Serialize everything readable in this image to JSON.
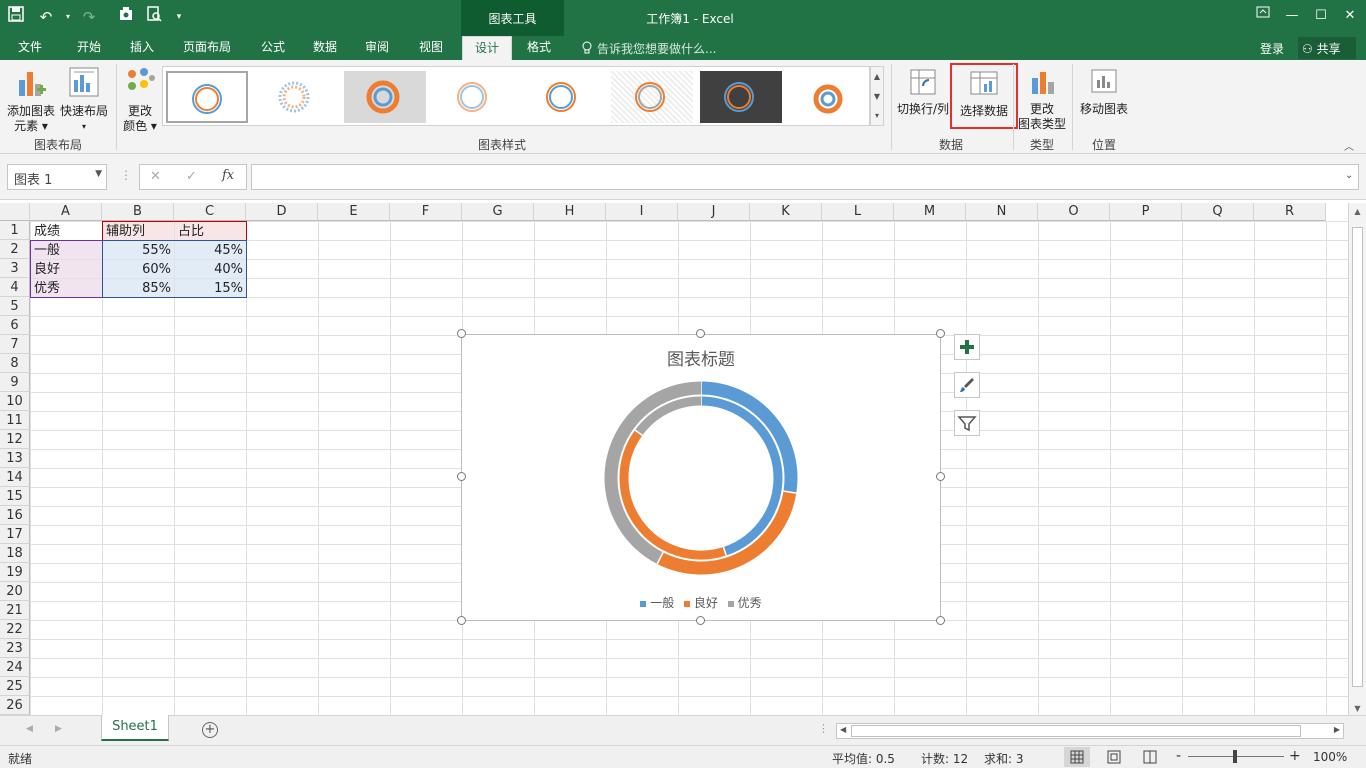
{
  "titlebar": {
    "context_tool_title": "图表工具",
    "doc_title": "工作簿1 - Excel"
  },
  "tabs": [
    {
      "label": "文件"
    },
    {
      "label": "开始"
    },
    {
      "label": "插入"
    },
    {
      "label": "页面布局"
    },
    {
      "label": "公式"
    },
    {
      "label": "数据"
    },
    {
      "label": "审阅"
    },
    {
      "label": "视图"
    },
    {
      "label": "设计"
    },
    {
      "label": "格式"
    }
  ],
  "tell_me": "告诉我您想要做什么...",
  "account": {
    "login": "登录",
    "share": "共享"
  },
  "ribbon": {
    "add_element": "添加图表",
    "add_element2": "元素",
    "quick_layout": "快速布局",
    "change_colors": "更改",
    "change_colors2": "颜色",
    "group_layout": "图表布局",
    "group_styles": "图表样式",
    "switch_row_col": "切换行/列",
    "select_data": "选择数据",
    "change_type": "更改",
    "change_type2": "图表类型",
    "move_chart": "移动图表",
    "group_data": "数据",
    "group_type": "类型",
    "group_location": "位置",
    "gallery_thumb_title": "图表标题"
  },
  "formula_bar": {
    "name_box": "图表 1",
    "fx": "fx",
    "cancel": "✕",
    "enter": "✓"
  },
  "sheet": {
    "columns": [
      "A",
      "B",
      "C",
      "D",
      "E",
      "F",
      "G",
      "H",
      "I",
      "J",
      "K",
      "L",
      "M",
      "N",
      "O",
      "P",
      "Q",
      "R"
    ],
    "rows": [
      "1",
      "2",
      "3",
      "4",
      "5",
      "6",
      "7",
      "8",
      "9",
      "10",
      "11",
      "12",
      "13",
      "14",
      "15",
      "16",
      "17",
      "18",
      "19",
      "20",
      "21",
      "22",
      "23",
      "24",
      "25",
      "26"
    ],
    "cells": [
      [
        "成绩",
        "辅助列",
        "占比"
      ],
      [
        "一般",
        "55%",
        "45%"
      ],
      [
        "良好",
        "60%",
        "40%"
      ],
      [
        "优秀",
        "85%",
        "15%"
      ]
    ]
  },
  "chart_data": {
    "type": "donut",
    "title": "图表标题",
    "categories": [
      "一般",
      "良好",
      "优秀"
    ],
    "series": [
      {
        "values": [
          0.55,
          0.6,
          0.85
        ]
      },
      {
        "values": [
          0.45,
          0.4,
          0.15
        ]
      }
    ],
    "colors": [
      "#5b9bd5",
      "#ed7d31",
      "#a5a5a5"
    ],
    "legend": "bottom"
  },
  "sheet_tabs": {
    "active": "Sheet1"
  },
  "statusbar": {
    "ready": "就绪",
    "average": "平均值: 0.5",
    "count": "计数: 12",
    "sum": "求和: 3",
    "zoom": "100%",
    "zoom_minus": "-",
    "zoom_plus": "+"
  },
  "highlight_color": "#e03030",
  "accent": "#217346"
}
